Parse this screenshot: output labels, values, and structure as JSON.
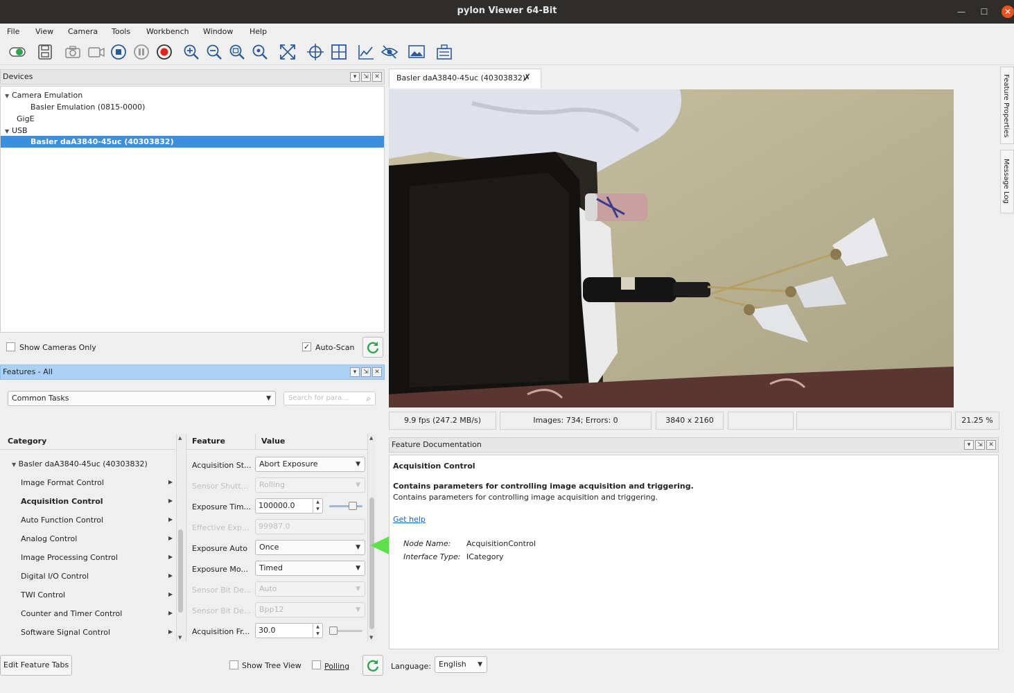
{
  "window": {
    "title": "pylon Viewer 64-Bit"
  },
  "menu": [
    "File",
    "View",
    "Camera",
    "Tools",
    "Workbench",
    "Window",
    "Help"
  ],
  "toolbar": {
    "icons": [
      "toggle-icon",
      "save-icon",
      "snapshot-icon",
      "video-icon",
      "stop-icon",
      "pause-icon",
      "record-icon",
      "zoom-in-icon",
      "zoom-out-icon",
      "zoom-fit-icon",
      "zoom-100-icon",
      "fullscreen-icon",
      "crosshair-icon",
      "grid-icon",
      "histogram-icon",
      "eye-icon",
      "image-icon",
      "settings-icon"
    ]
  },
  "devices": {
    "title": "Devices",
    "tree": [
      {
        "label": "Camera Emulation",
        "level": 0,
        "expanded": true
      },
      {
        "label": "Basler Emulation (0815-0000)",
        "level": 1
      },
      {
        "label": "GigE",
        "level": 0
      },
      {
        "label": "USB",
        "level": 0,
        "expanded": true
      },
      {
        "label": "Basler daA3840-45uc (40303832)",
        "level": 1,
        "selected": true
      }
    ],
    "show_cameras_only": "Show Cameras Only",
    "auto_scan": "Auto-Scan",
    "auto_scan_checked": "✓"
  },
  "features": {
    "title": "Features - All",
    "task_select": "Common Tasks",
    "search_placeholder": "Search for para...",
    "category_header": "Category",
    "feature_header": "Feature",
    "value_header": "Value",
    "camera_node": "Basler daA3840-45uc (40303832)",
    "categories": [
      "Image Format Control",
      "Acquisition Control",
      "Auto Function Control",
      "Analog Control",
      "Image Processing Control",
      "Digital I/O Control",
      "TWI Control",
      "Counter and Timer Control",
      "Software Signal Control"
    ],
    "rows": [
      {
        "feature": "Acquisition St...",
        "value": "Abort Exposure",
        "kind": "combo",
        "enabled": true
      },
      {
        "feature": "Sensor Shutt...",
        "value": "Rolling",
        "kind": "combo",
        "enabled": false
      },
      {
        "feature": "Exposure Tim...",
        "value": "100000.0",
        "kind": "spin",
        "enabled": true
      },
      {
        "feature": "Effective Exp...",
        "value": "99987.0",
        "kind": "text",
        "enabled": false
      },
      {
        "feature": "Exposure Auto",
        "value": "Once",
        "kind": "combo",
        "enabled": true
      },
      {
        "feature": "Exposure Mo...",
        "value": "Timed",
        "kind": "combo",
        "enabled": true
      },
      {
        "feature": "Sensor Bit De...",
        "value": "Auto",
        "kind": "combo",
        "enabled": false
      },
      {
        "feature": "Sensor Bit De...",
        "value": "Bpp12",
        "kind": "combo",
        "enabled": false
      },
      {
        "feature": "Acquisition Fr...",
        "value": "30.0",
        "kind": "spin",
        "enabled": true
      }
    ],
    "edit_tabs": "Edit Feature Tabs",
    "show_tree_view": "Show Tree View",
    "polling": "Polling"
  },
  "image_view": {
    "tab": "Basler daA3840-45uc (40303832)",
    "fps": "9.9 fps (247.2 MB/s)",
    "images": "Images: 734; Errors: 0",
    "resolution": "3840 x 2160",
    "zoom": "21.25 %"
  },
  "side_tabs": [
    "Feature Properties",
    "Message Log"
  ],
  "documentation": {
    "title": "Feature Documentation",
    "heading": "Acquisition Control",
    "summary": "Contains parameters for controlling image acquisition and triggering.",
    "description": "Contains parameters for controlling image acquisition and triggering.",
    "help_link": "Get help",
    "node_name_label": "Node Name:",
    "node_name": "AcquisitionControl",
    "interface_label": "Interface Type:",
    "interface": "ICategory"
  },
  "language": {
    "label": "Language:",
    "value": "English"
  },
  "colors": {
    "selection": "#3d8fdc",
    "active_header": "#a8d1f5",
    "annotation_arrow": "#5ee04a",
    "refresh": "#2ea44f"
  }
}
